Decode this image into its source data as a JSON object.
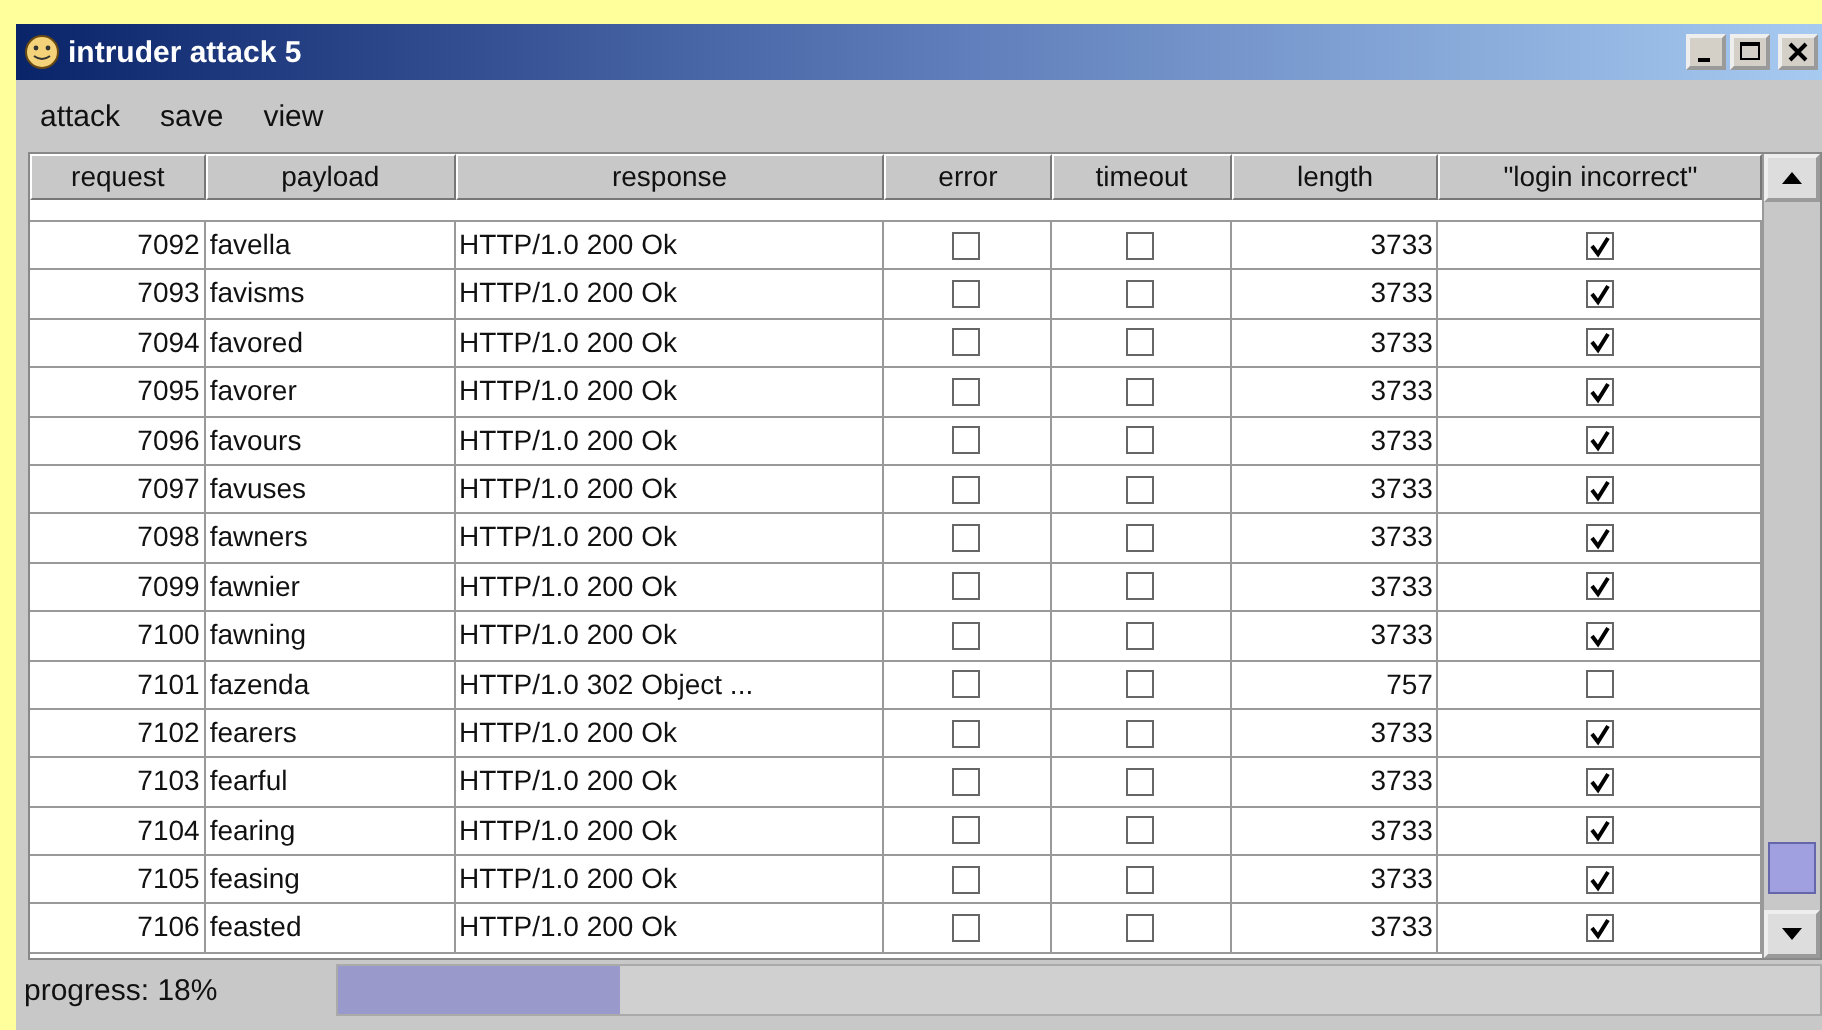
{
  "window": {
    "title": "intruder attack 5"
  },
  "menu": [
    "attack",
    "save",
    "view"
  ],
  "table": {
    "columns": [
      "request",
      "payload",
      "response",
      "error",
      "timeout",
      "length",
      "\"login incorrect\""
    ],
    "rows": [
      {
        "request": "7092",
        "payload": "favella",
        "response": "HTTP/1.0 200 Ok",
        "error": false,
        "timeout": false,
        "length": "3733",
        "login_incorrect": true
      },
      {
        "request": "7093",
        "payload": "favisms",
        "response": "HTTP/1.0 200 Ok",
        "error": false,
        "timeout": false,
        "length": "3733",
        "login_incorrect": true
      },
      {
        "request": "7094",
        "payload": "favored",
        "response": "HTTP/1.0 200 Ok",
        "error": false,
        "timeout": false,
        "length": "3733",
        "login_incorrect": true
      },
      {
        "request": "7095",
        "payload": "favorer",
        "response": "HTTP/1.0 200 Ok",
        "error": false,
        "timeout": false,
        "length": "3733",
        "login_incorrect": true
      },
      {
        "request": "7096",
        "payload": "favours",
        "response": "HTTP/1.0 200 Ok",
        "error": false,
        "timeout": false,
        "length": "3733",
        "login_incorrect": true
      },
      {
        "request": "7097",
        "payload": "favuses",
        "response": "HTTP/1.0 200 Ok",
        "error": false,
        "timeout": false,
        "length": "3733",
        "login_incorrect": true
      },
      {
        "request": "7098",
        "payload": "fawners",
        "response": "HTTP/1.0 200 Ok",
        "error": false,
        "timeout": false,
        "length": "3733",
        "login_incorrect": true
      },
      {
        "request": "7099",
        "payload": "fawnier",
        "response": "HTTP/1.0 200 Ok",
        "error": false,
        "timeout": false,
        "length": "3733",
        "login_incorrect": true
      },
      {
        "request": "7100",
        "payload": "fawning",
        "response": "HTTP/1.0 200 Ok",
        "error": false,
        "timeout": false,
        "length": "3733",
        "login_incorrect": true
      },
      {
        "request": "7101",
        "payload": "fazenda",
        "response": "HTTP/1.0 302 Object ...",
        "error": false,
        "timeout": false,
        "length": "757",
        "login_incorrect": false
      },
      {
        "request": "7102",
        "payload": "fearers",
        "response": "HTTP/1.0 200 Ok",
        "error": false,
        "timeout": false,
        "length": "3733",
        "login_incorrect": true
      },
      {
        "request": "7103",
        "payload": "fearful",
        "response": "HTTP/1.0 200 Ok",
        "error": false,
        "timeout": false,
        "length": "3733",
        "login_incorrect": true
      },
      {
        "request": "7104",
        "payload": "fearing",
        "response": "HTTP/1.0 200 Ok",
        "error": false,
        "timeout": false,
        "length": "3733",
        "login_incorrect": true
      },
      {
        "request": "7105",
        "payload": "feasing",
        "response": "HTTP/1.0 200 Ok",
        "error": false,
        "timeout": false,
        "length": "3733",
        "login_incorrect": true
      },
      {
        "request": "7106",
        "payload": "feasted",
        "response": "HTTP/1.0 200 Ok",
        "error": false,
        "timeout": false,
        "length": "3733",
        "login_incorrect": true
      }
    ]
  },
  "status": {
    "label": "progress: 18%",
    "level": 0.19
  }
}
